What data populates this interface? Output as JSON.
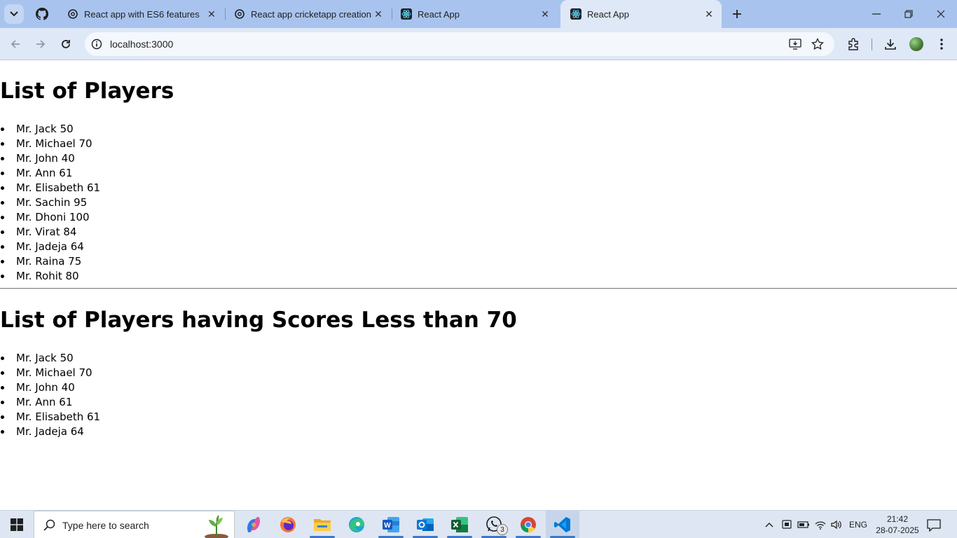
{
  "browser": {
    "tabs": [
      {
        "title": "React app with ES6 features",
        "icon": "openai-icon"
      },
      {
        "title": "React app cricketapp creation",
        "icon": "openai-icon"
      },
      {
        "title": "React App",
        "icon": "react-icon"
      },
      {
        "title": "React App",
        "icon": "react-icon",
        "active": true
      }
    ],
    "address": "localhost:3000"
  },
  "page": {
    "heading1": "List of Players",
    "players": [
      "Mr. Jack 50",
      "Mr. Michael 70",
      "Mr. John 40",
      "Mr. Ann 61",
      "Mr. Elisabeth 61",
      "Mr. Sachin 95",
      "Mr. Dhoni 100",
      "Mr. Virat 84",
      "Mr. Jadeja 64",
      "Mr. Raina 75",
      "Mr. Rohit 80"
    ],
    "heading2": "List of Players having Scores Less than 70",
    "filtered_players": [
      "Mr. Jack 50",
      "Mr. Michael 70",
      "Mr. John 40",
      "Mr. Ann 61",
      "Mr. Elisabeth 61",
      "Mr. Jadeja 64"
    ]
  },
  "taskbar": {
    "search_placeholder": "Type here to search",
    "apps": [
      "copilot-icon",
      "firefox-icon",
      "file-explorer-icon",
      "edge-icon",
      "word-icon",
      "outlook-icon",
      "excel-icon",
      "whatsapp-icon",
      "chrome-icon",
      "vscode-icon"
    ],
    "whatsapp_badge": "3",
    "language": "ENG",
    "time": "21:42",
    "date": "28-07-2025"
  },
  "colors": {
    "tabstrip": "#a8c4ee",
    "toolbar": "#dfe8f7",
    "taskbar": "#dde6f2"
  }
}
